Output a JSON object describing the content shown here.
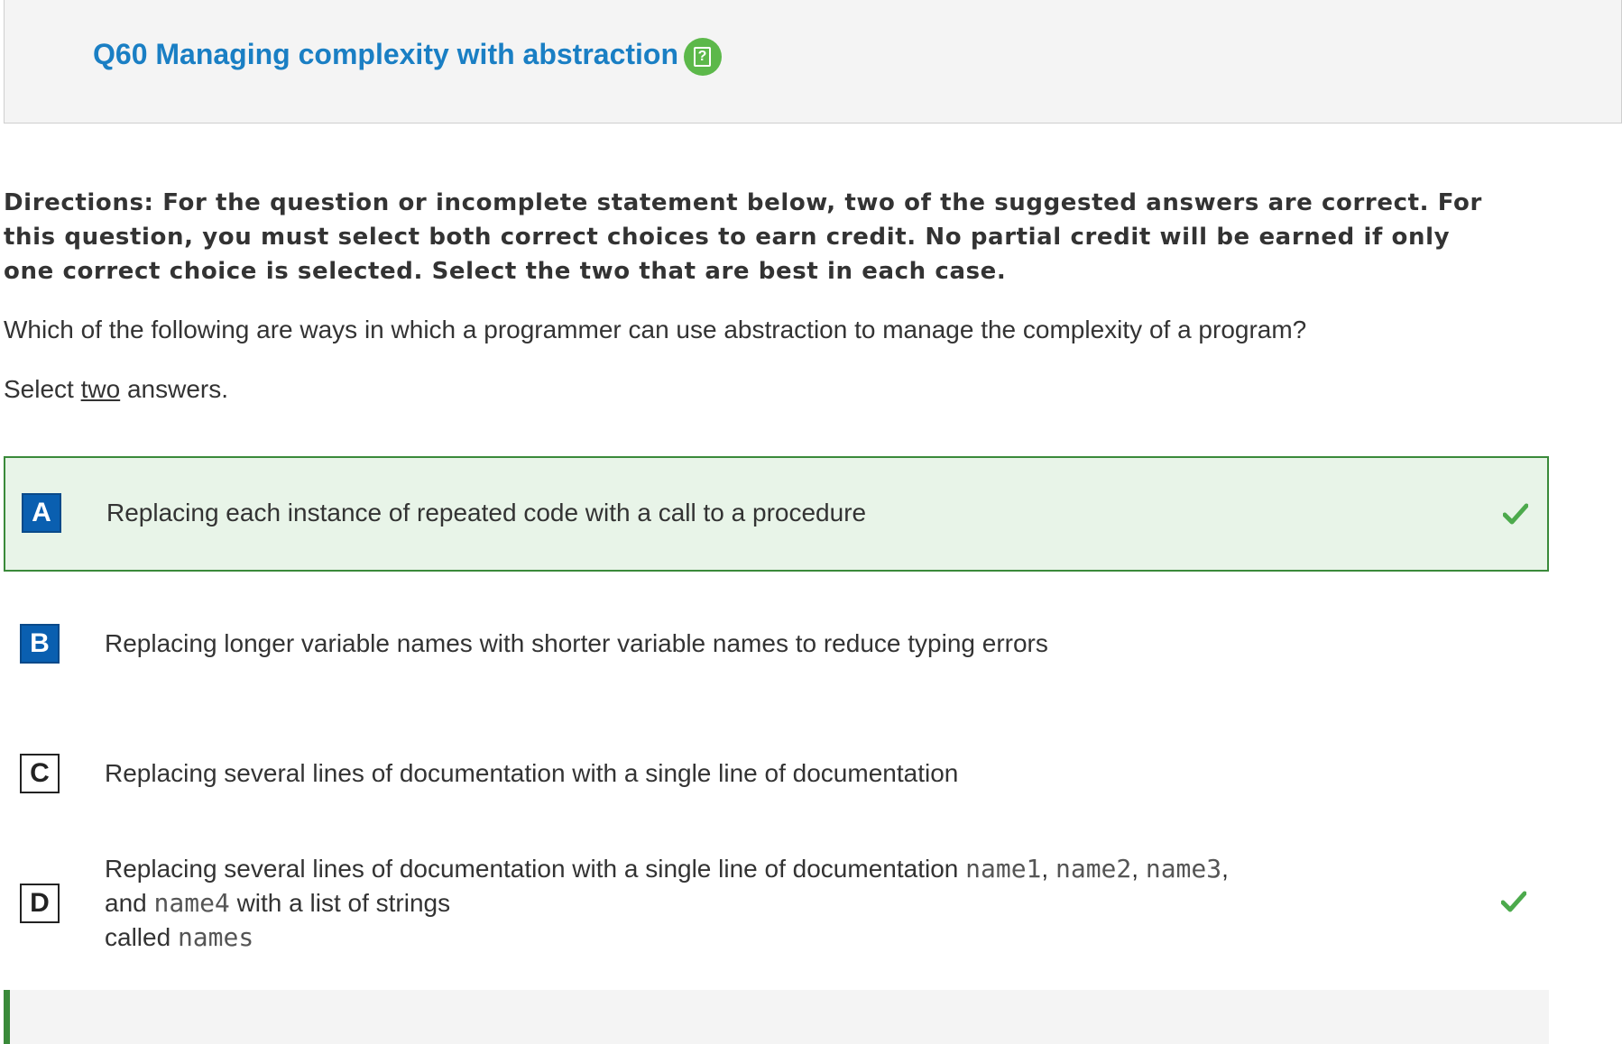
{
  "header": {
    "question_title": "Q60 Managing complexity with abstraction",
    "help_icon": "help-icon"
  },
  "directions": "Directions: For the question or incomplete statement below, two of the suggested answers are correct. For this question, you must select both correct choices to earn credit. No partial credit will be earned if only one correct choice is selected. Select the two that are best in each case.",
  "prompt": "Which of the following are ways in which a programmer can use abstraction to manage the complexity of a program?",
  "select_note": {
    "before": "Select ",
    "underlined": "two",
    "after": " answers."
  },
  "choices": [
    {
      "letter": "A",
      "text": "Replacing each instance of repeated code with a call to a procedure",
      "correct": true,
      "selected": true
    },
    {
      "letter": "B",
      "text": "Replacing longer variable names with shorter variable names to reduce typing errors",
      "correct": false,
      "selected": true
    },
    {
      "letter": "C",
      "text": "Replacing several lines of documentation with a single line of documentation",
      "correct": false,
      "selected": false
    },
    {
      "letter": "D",
      "text_parts": {
        "p1": "Replacing several lines of documentation with a single line of documentation",
        "c1": "name1",
        "s1": ",",
        "c2": "name2",
        "s2": ",",
        "c3": "name3",
        "s3": ",",
        "p2": "and",
        "c4": "name4",
        "p3": "with a list of strings",
        "p4": "called",
        "c5": "names"
      },
      "correct": true,
      "selected": false
    }
  ],
  "colors": {
    "title_blue": "#1a7fc4",
    "correct_green": "#3a8a3a",
    "correct_bg": "#e8f4e8",
    "letter_blue": "#0a5fb0",
    "check_green": "#4caa4c"
  },
  "icons": {
    "check": "checkmark-icon"
  }
}
